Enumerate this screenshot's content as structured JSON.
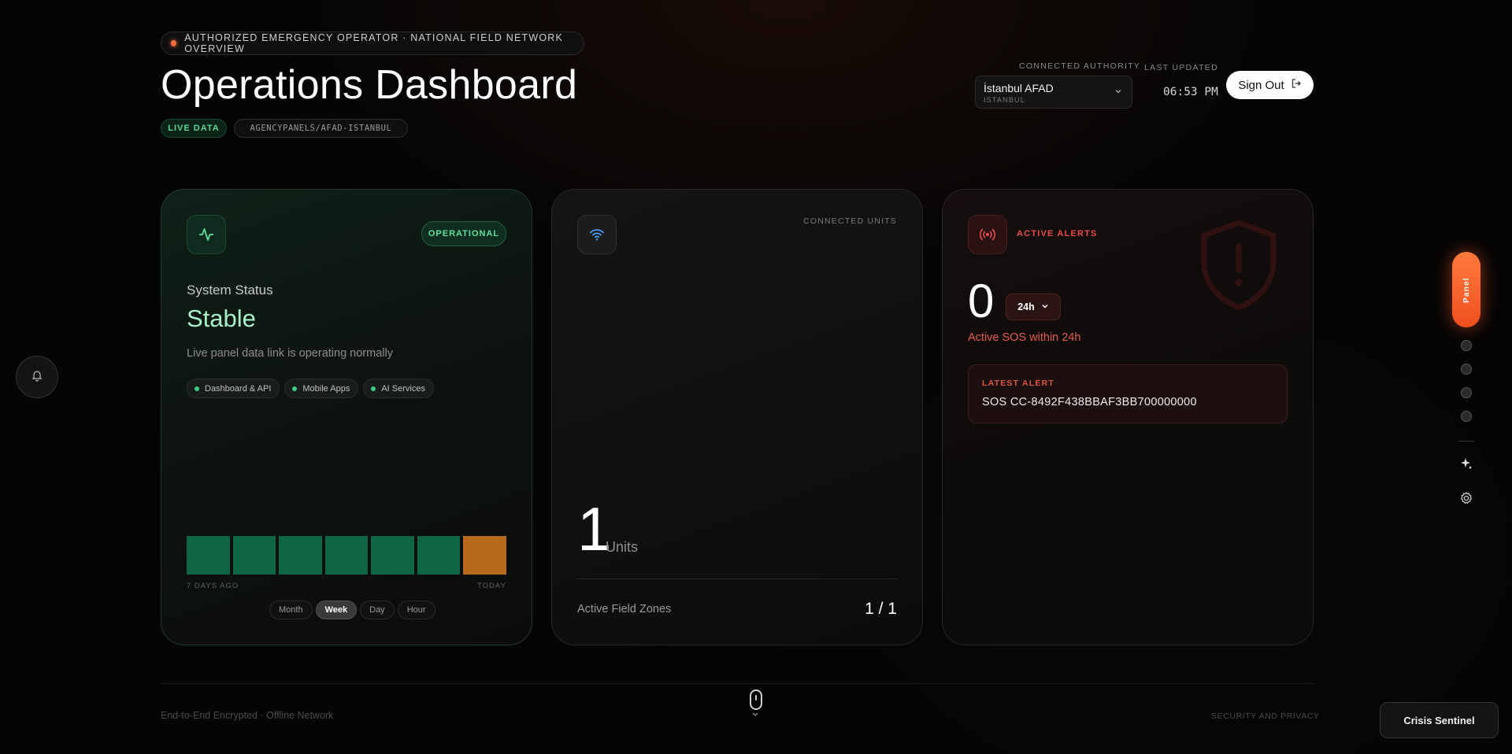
{
  "header": {
    "operator_banner": "AUTHORIZED EMERGENCY OPERATOR · NATIONAL FIELD NETWORK OVERVIEW",
    "title": "Operations Dashboard",
    "live_tag": "LIVE DATA",
    "path_tag": "AGENCYPANELS/AFAD-ISTANBUL",
    "authority_label": "CONNECTED AUTHORITY",
    "authority_name": "İstanbul AFAD",
    "authority_sub": "ISTANBUL",
    "updated_label": "LAST UPDATED",
    "updated_time": "06:53 PM",
    "signout_label": "Sign Out"
  },
  "status_card": {
    "badge": "OPERATIONAL",
    "label": "System Status",
    "value": "Stable",
    "description": "Live panel data link is operating normally",
    "chips": [
      "Dashboard & API",
      "Mobile Apps",
      "AI Services"
    ],
    "uptime_bars": [
      "ok",
      "ok",
      "ok",
      "ok",
      "ok",
      "ok",
      "warn"
    ],
    "axis_left": "7 DAYS AGO",
    "axis_right": "TODAY",
    "ranges": [
      "Month",
      "Week",
      "Day",
      "Hour"
    ],
    "active_range": "Week"
  },
  "units_card": {
    "label": "CONNECTED UNITS",
    "count": "1",
    "count_word": "Units",
    "zones_label": "Active Field Zones",
    "zones_value": "1 / 1"
  },
  "alerts_card": {
    "title": "ACTIVE ALERTS",
    "count": "0",
    "range": "24h",
    "subtitle": "Active SOS within 24h",
    "latest_label": "LATEST ALERT",
    "latest_value": "SOS CC-8492F438BBAF3BB700000000"
  },
  "rail": {
    "panel_label": "Panel"
  },
  "footer": {
    "left": "End-to-End Encrypted · Offline Network",
    "right": "SECURITY AND PRIVACY",
    "sentinel": "Crisis Sentinel"
  },
  "colors": {
    "accent_orange": "#f26a3d",
    "ok_green": "#0f6644",
    "warn_amber": "#b86a1c",
    "alert_red": "#e84b4b"
  }
}
